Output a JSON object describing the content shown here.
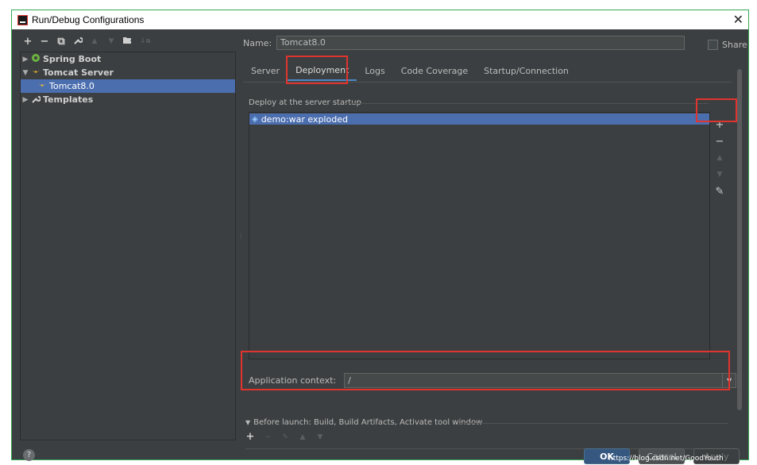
{
  "window": {
    "title": "Run/Debug Configurations"
  },
  "toolbar": {
    "add": "+",
    "remove": "−",
    "copy": "⧉",
    "edit": "🔧",
    "up": "▲",
    "down": "▼",
    "folder": "📁",
    "sort": "↓a"
  },
  "tree": {
    "items": [
      {
        "label": "Spring Boot",
        "arrow": "▶",
        "icon": "spring-boot-icon"
      },
      {
        "label": "Tomcat Server",
        "arrow": "▼",
        "icon": "tomcat-icon"
      },
      {
        "label": "Tomcat8.0",
        "arrow": "",
        "icon": "tomcat-icon",
        "selected": true
      },
      {
        "label": "Templates",
        "arrow": "▶",
        "icon": "wrench-icon"
      }
    ]
  },
  "name_field": {
    "label": "Name:",
    "value": "Tomcat8.0"
  },
  "share": {
    "label": "Share"
  },
  "tabs": [
    {
      "label": "Server"
    },
    {
      "label": "Deployment",
      "active": true
    },
    {
      "label": "Logs"
    },
    {
      "label": "Code Coverage"
    },
    {
      "label": "Startup/Connection"
    }
  ],
  "deployment": {
    "section_label": "Deploy at the server startup",
    "items": [
      {
        "label": "demo:war exploded"
      }
    ],
    "tools": {
      "add": "+",
      "remove": "−",
      "up": "▲",
      "down": "▼",
      "edit": "✎"
    }
  },
  "app_context": {
    "label": "Application context:",
    "value": "/"
  },
  "before_launch": {
    "label": "Before launch: Build, Build Artifacts, Activate tool window"
  },
  "buttons": {
    "help": "?",
    "ok": "OK",
    "cancel": "Cancel",
    "apply": "Apply"
  },
  "watermark": "https://blog.csdn.net/GoodYouth"
}
